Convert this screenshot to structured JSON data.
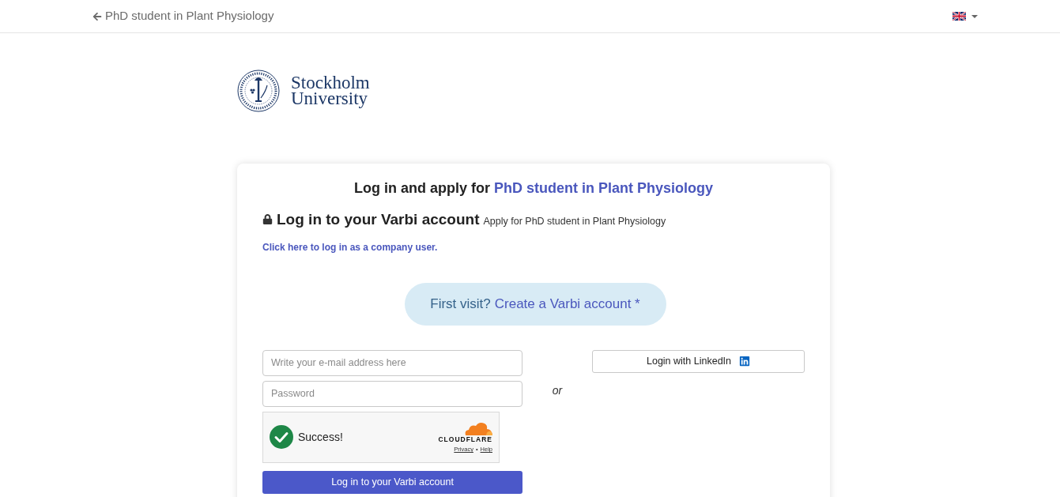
{
  "top_bar": {
    "back_label": "PhD student in Plant Physiology"
  },
  "logo": {
    "name_line_1": "Stockholm",
    "name_line_2": "University"
  },
  "card": {
    "title": {
      "prefix": "Log in and apply for",
      "job_link": "PhD student in Plant Physiology"
    },
    "section_heading": "Log in to your Varbi account",
    "section_subheading": "Apply for PhD student in Plant Physiology",
    "company_link": "Click here to log in as a company user.",
    "first_visit": {
      "question": "First visit?",
      "link": "Create a Varbi account *"
    },
    "login_form": {
      "email": {
        "placeholder": "Write your e-mail address here"
      },
      "password": {
        "placeholder": "Password"
      },
      "captcha": {
        "verified": true,
        "status": "Success!",
        "brand": "CLOUDFLARE",
        "links": [
          "Privacy",
          "Help"
        ],
        "separator": "•"
      },
      "submit_button": "Log in to your Varbi account"
    },
    "divider_text": "or",
    "linkedin_button": "Login with LinkedIn"
  }
}
